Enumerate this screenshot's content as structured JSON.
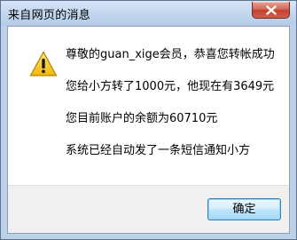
{
  "window": {
    "title": "来自网页的消息"
  },
  "dialog": {
    "icon": "warning-icon",
    "lines": [
      "尊敬的guan_xige会员，恭喜您转帐成功",
      "您给小方转了1000元，他现在有3649元",
      "您目前账户的余额为60710元",
      "系统已经自动发了一条短信通知小方"
    ],
    "ok_label": "确定"
  },
  "colors": {
    "titlebar": "#c2d6ee",
    "close_button": "#c3402c",
    "warning_fill": "#f5c51c"
  }
}
